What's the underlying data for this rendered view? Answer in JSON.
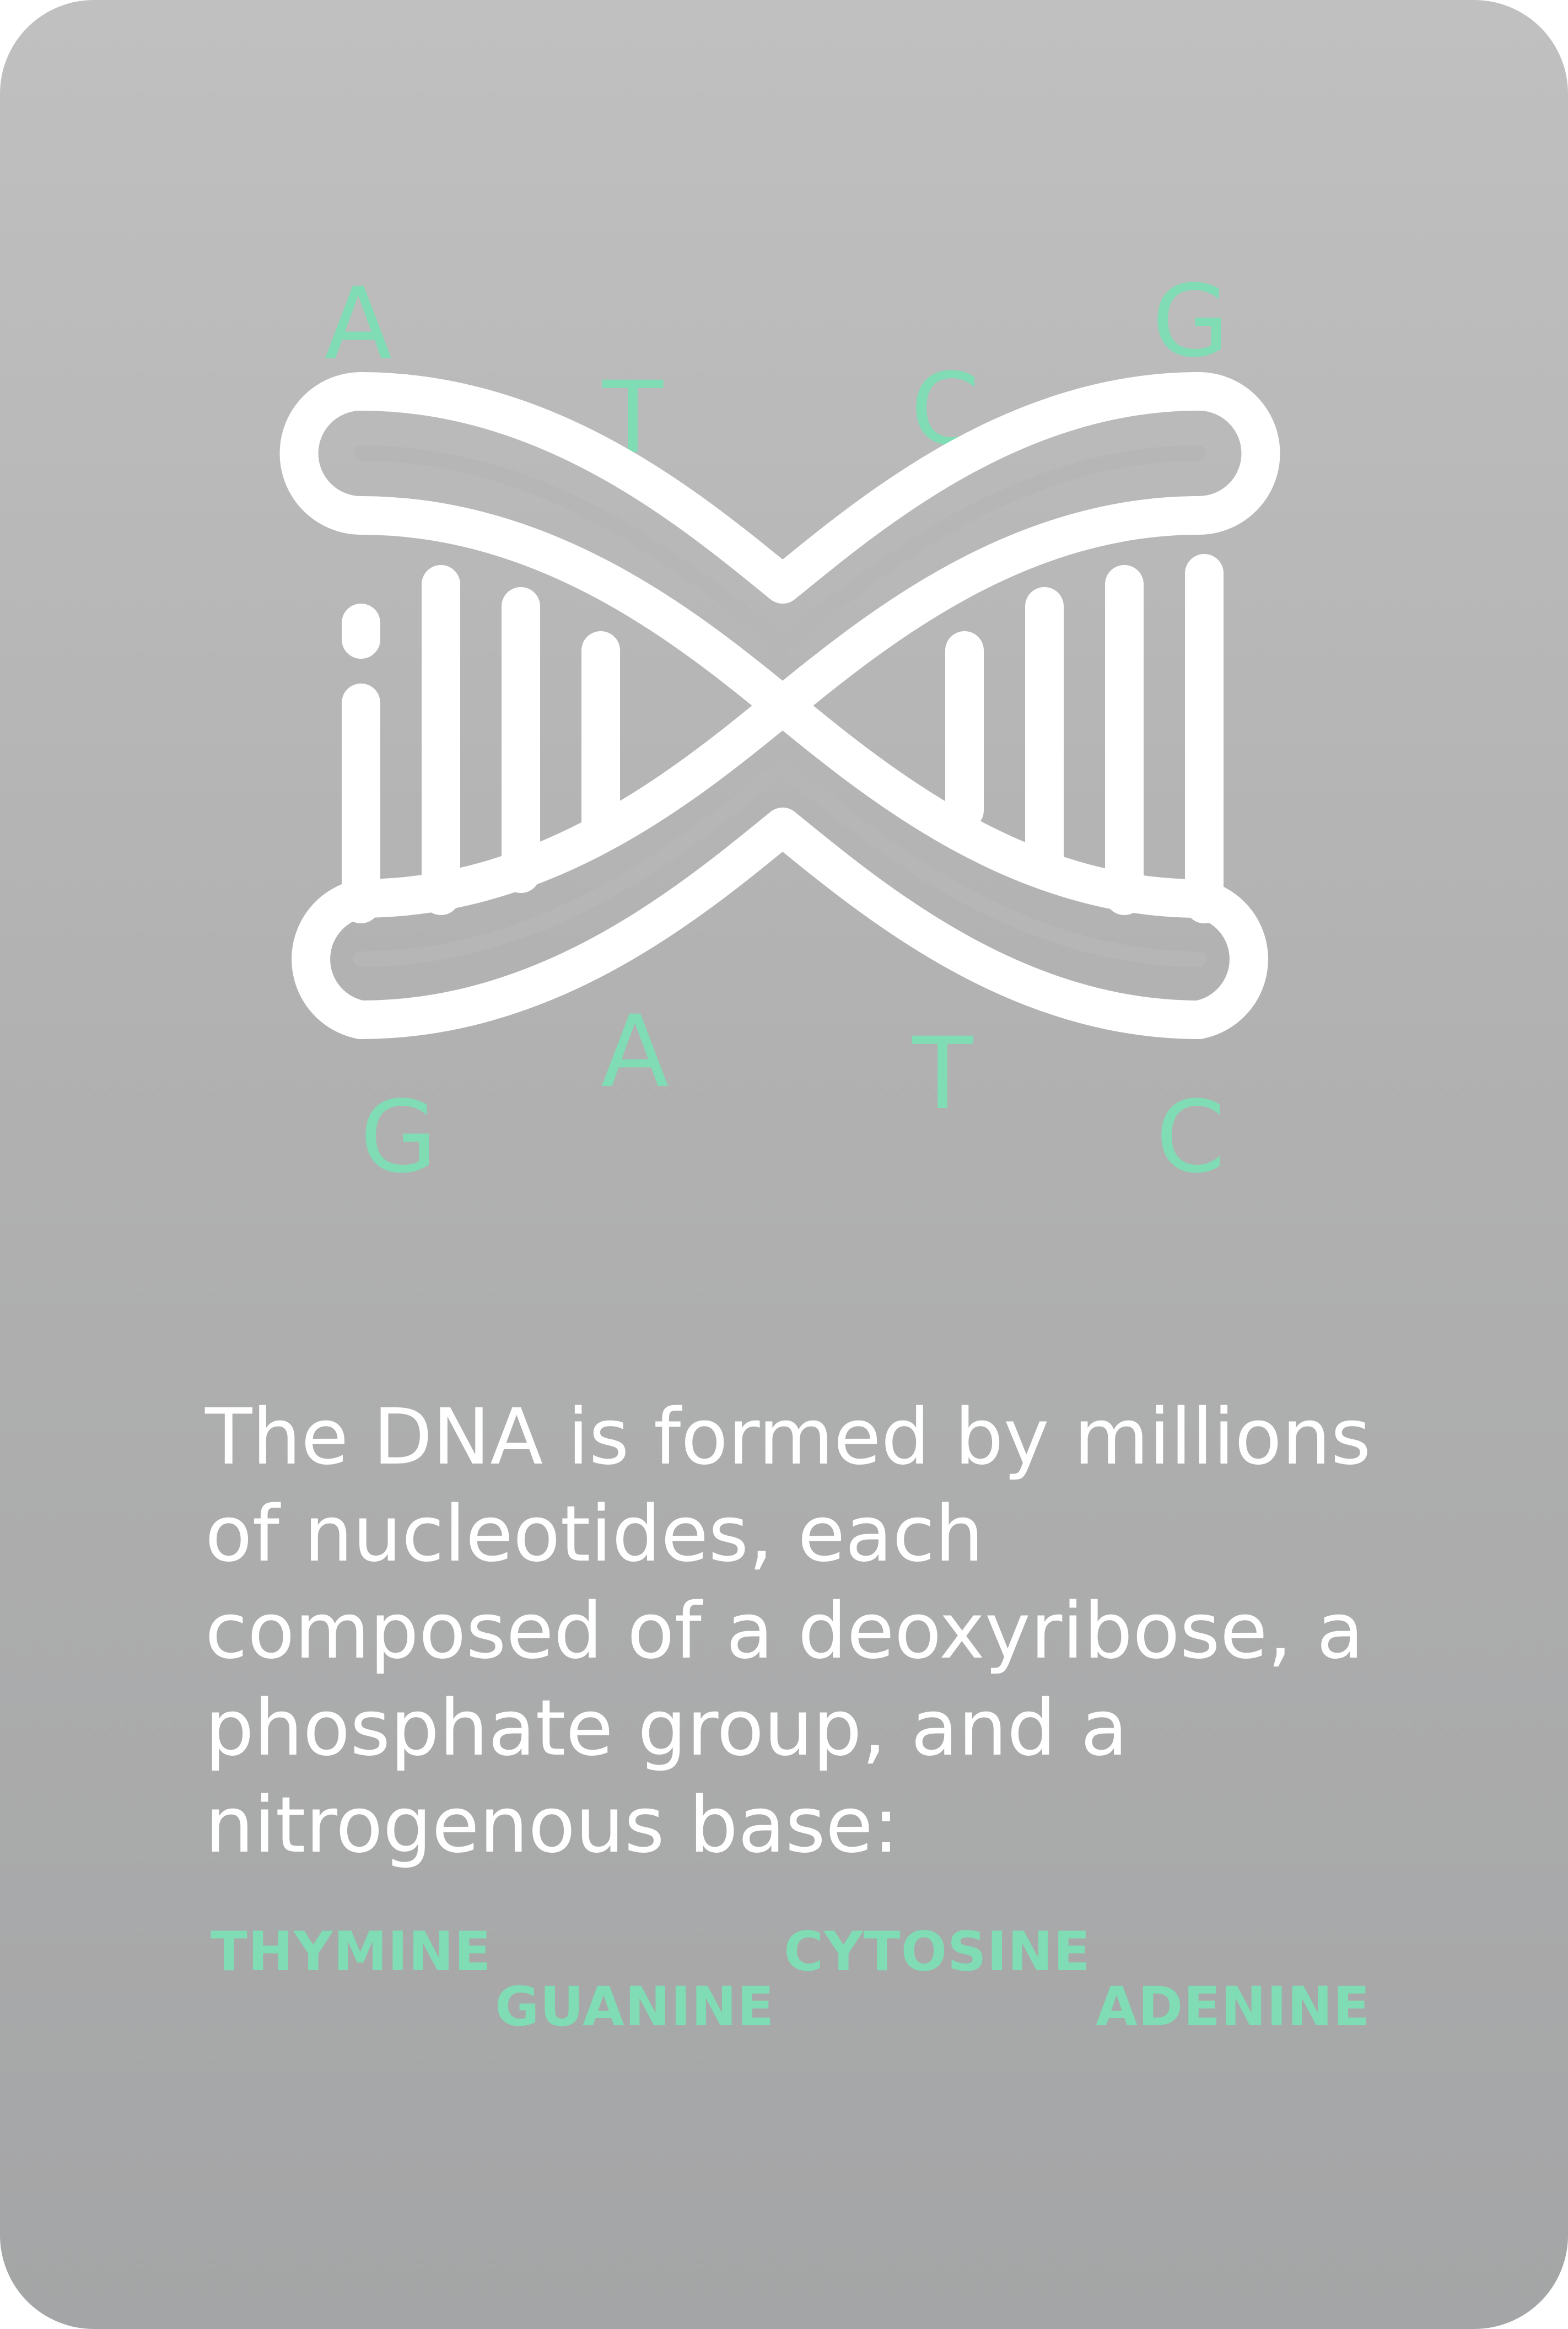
{
  "colors": {
    "accent": "#7fdcb4",
    "text": "#ffffff",
    "background_top": "#c0c0c0",
    "background_bottom": "#a4a5a6"
  },
  "illustration": {
    "icon": "dna-icon",
    "letters_top": [
      "A",
      "T",
      "C",
      "G"
    ],
    "letters_bottom": [
      "G",
      "A",
      "T",
      "C"
    ]
  },
  "description": "The DNA is formed by millions of nucleotides, each composed of a deoxyribose, a phosphate group, and a nitrogenous base:",
  "bases": [
    "THYMINE",
    "GUANINE",
    "CYTOSINE",
    "ADENINE"
  ]
}
